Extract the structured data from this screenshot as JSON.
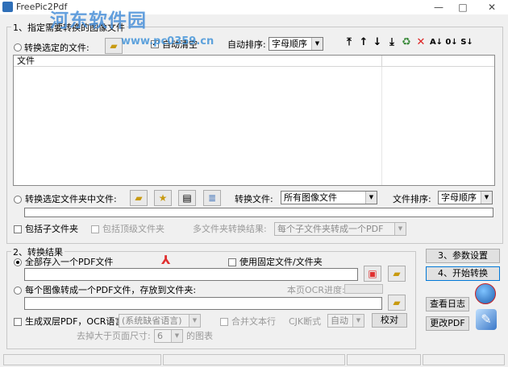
{
  "window": {
    "title": "FreePic2Pdf",
    "minimize": "—",
    "maximize": "□",
    "close": "✕"
  },
  "watermark": {
    "site": "河东软件园",
    "url": "www.pc0359.cn"
  },
  "section1": {
    "label": "1、指定需要转换的图像文件",
    "radio_files": "转换选定的文件:",
    "auto_clear": "自动清空",
    "sort_label": "自动排序:",
    "sort_value": "字母顺序",
    "list_column_file": "文件",
    "radio_folder": "转换选定文件夹中文件:",
    "convert_files_label": "转换文件:",
    "convert_files_value": "所有图像文件",
    "file_sort_label": "文件排序:",
    "file_sort_value": "字母顺序",
    "include_subfolders": "包括子文件夹",
    "include_top_folder": "包括顶级文件夹",
    "multi_folder_label": "多文件夹转换结果:",
    "multi_folder_value": "每个子文件夹转成一个PDF"
  },
  "section2": {
    "label": "2、转换结果",
    "radio_all_one": "全部存入一个PDF文件",
    "use_fixed_folder": "使用固定文件/文件夹",
    "radio_each": "每个图像转成一个PDF文件，存放到文件夹:",
    "ocr_progress_label": "本页OCR进度:",
    "dual_layer": "生成双层PDF，OCR语言:",
    "ocr_lang_value": "(系统缺省语言)",
    "merge_lines": "合并文本行",
    "cjk_label": "CJK断式",
    "cjk_value": "自动",
    "calibrate_button": "校对",
    "remove_size_prefix": "去掉大于页面尺寸:",
    "remove_size_value": "6",
    "remove_size_suffix": "的图表"
  },
  "buttons": {
    "params": "3、参数设置",
    "start": "4、开始转换",
    "view_log": "查看日志",
    "modify_pdf": "更改PDF"
  },
  "colors": {
    "accent": "#0078d7",
    "pdf_red": "#e03030",
    "watermark": "#4a90d9"
  }
}
